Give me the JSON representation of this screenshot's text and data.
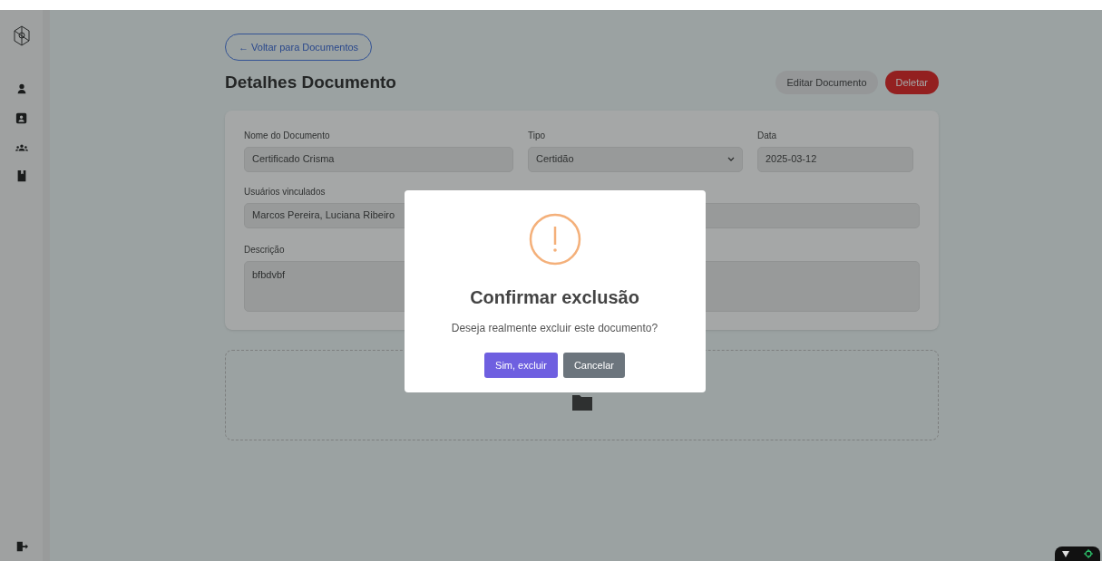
{
  "back_link": "← Voltar para Documentos",
  "title": "Detalhes Documento",
  "actions": [
    {
      "label": "Editar Documento",
      "kind": "secondary"
    },
    {
      "label": "Deletar",
      "kind": "danger"
    }
  ],
  "fields": [
    {
      "label": "Nome do Documento",
      "value": "Certificado Crisma",
      "kind": "text"
    },
    {
      "label": "Tipo",
      "value": "Certidão",
      "kind": "select"
    },
    {
      "label": "Data",
      "value": "2025-03-12",
      "kind": "text"
    }
  ],
  "linked_users": {
    "label": "Usuários vinculados",
    "value": "Marcos Pereira, Luciana Ribeiro"
  },
  "description": {
    "label": "Descrição",
    "value": "bfbdvbf"
  },
  "dialog": {
    "title": "Confirmar exclusão",
    "message": "Deseja realmente excluir este documento?",
    "confirm": "Sim, excluir",
    "cancel": "Cancelar"
  }
}
